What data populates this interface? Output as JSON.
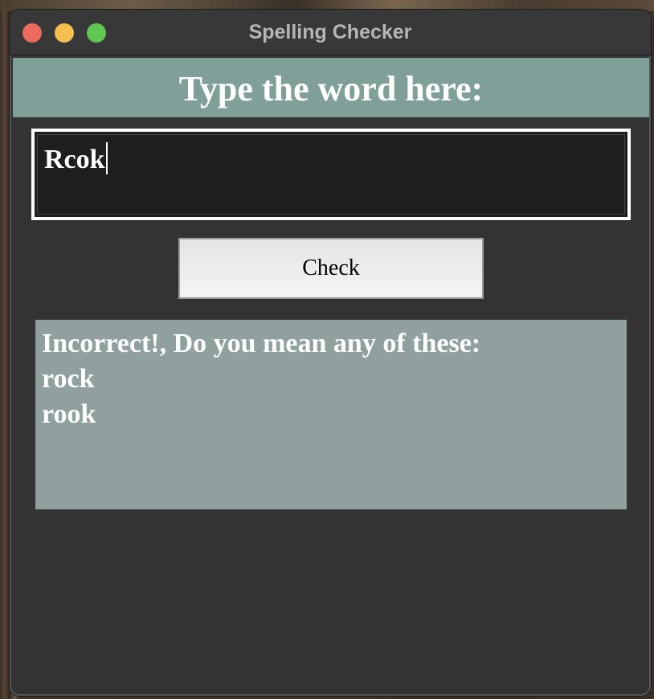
{
  "window": {
    "title": "Spelling Checker"
  },
  "heading": {
    "text": "Type the word here:"
  },
  "word_input": {
    "value": "Rcok"
  },
  "check_button": {
    "label": "Check"
  },
  "result": {
    "message": "Incorrect!, Do you mean any of these:",
    "suggestions": [
      "rock",
      "rook"
    ]
  },
  "colors": {
    "heading_bg": "#7f9f98",
    "result_bg": "#90a09e",
    "window_bg": "#333333",
    "input_bg": "#1e1e1e"
  }
}
